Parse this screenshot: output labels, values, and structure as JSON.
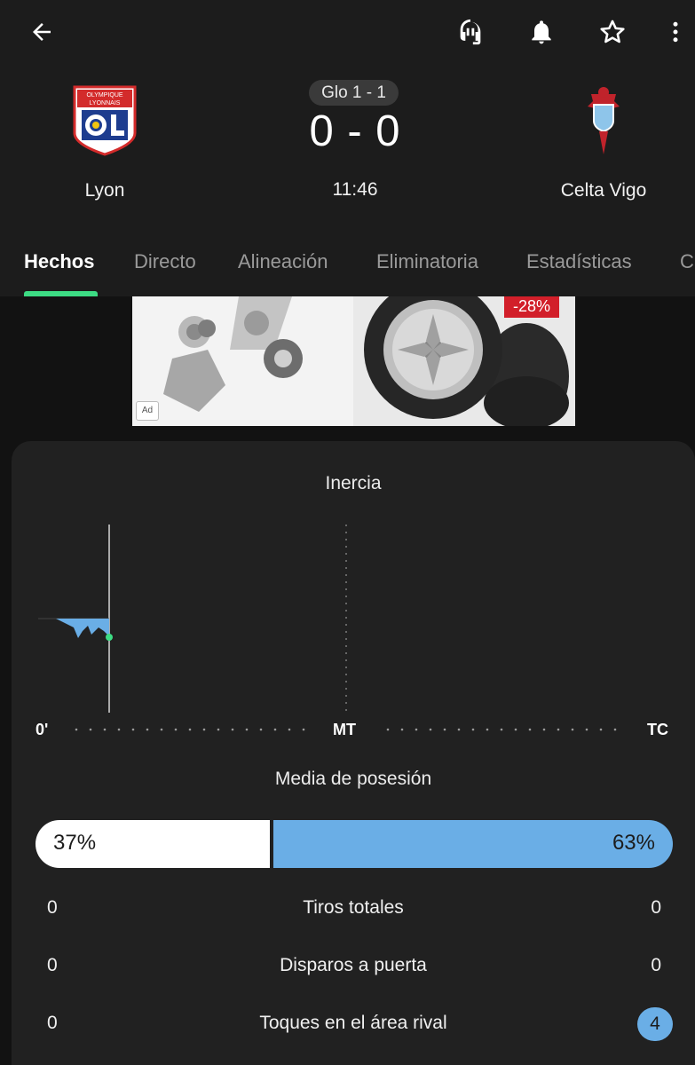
{
  "toolbar": {
    "back_icon": "arrow-back-icon",
    "audio_icon": "headset-icon",
    "notify_icon": "bell-icon",
    "favorite_icon": "star-outline-icon",
    "more_icon": "more-vertical-icon"
  },
  "match": {
    "home": {
      "name": "Lyon",
      "logo_text_1": "OLYMPIQUE",
      "logo_text_2": "LYONNAIS",
      "logo_monogram": "OL"
    },
    "away": {
      "name": "Celta Vigo"
    },
    "aggregate": "Glo 1 - 1",
    "score": "0 - 0",
    "time": "11:46"
  },
  "tabs": [
    {
      "label": "Hechos",
      "active": true
    },
    {
      "label": "Directo",
      "active": false
    },
    {
      "label": "Alineación",
      "active": false
    },
    {
      "label": "Eliminatoria",
      "active": false
    },
    {
      "label": "Estadísticas",
      "active": false
    },
    {
      "label": "C",
      "active": false
    }
  ],
  "ad": {
    "badge": "Ad",
    "discount": "-28%"
  },
  "momentum": {
    "title": "Inercia",
    "axis": {
      "start": "0'",
      "half": "MT",
      "end": "TC"
    }
  },
  "possession": {
    "title": "Media de posesión",
    "home_pct": 37,
    "away_pct": 63,
    "home_label": "37%",
    "away_label": "63%"
  },
  "stats": [
    {
      "label": "Tiros totales",
      "home": "0",
      "away": "0",
      "away_highlight": false
    },
    {
      "label": "Disparos a puerta",
      "home": "0",
      "away": "0",
      "away_highlight": false
    },
    {
      "label": "Toques en el área rival",
      "home": "0",
      "away": "4",
      "away_highlight": true
    }
  ],
  "colors": {
    "accent": "#3ddc84",
    "away_bar": "#6aaee6",
    "home_bar": "#ffffff",
    "momentum_fill": "#6aaee6"
  }
}
